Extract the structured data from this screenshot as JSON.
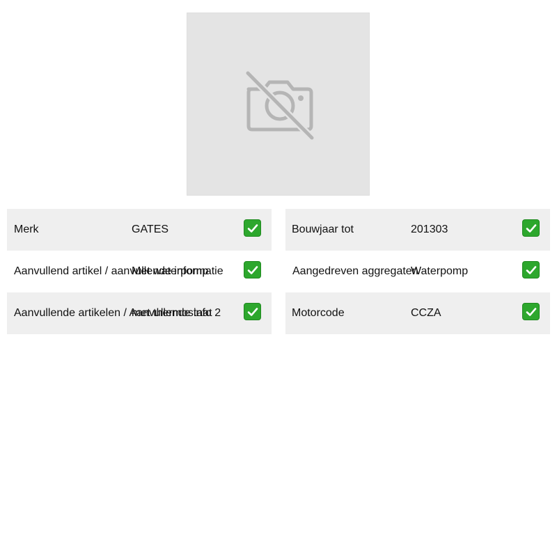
{
  "product_image": {
    "icon": "no-photo-camera-icon",
    "background_color": "#e4e4e4",
    "icon_color": "#b5b5b5"
  },
  "specs_left": [
    {
      "label": "Merk",
      "value": "GATES",
      "status_icon": "check-icon"
    },
    {
      "label": "Aanvullend artikel / aanvullende informatie",
      "value": "Met waterpomp",
      "status_icon": "check-icon"
    },
    {
      "label": "Aanvullende artikelen / Aanvullende info 2",
      "value": "met thermostaat",
      "status_icon": "check-icon"
    }
  ],
  "specs_right": [
    {
      "label": "Bouwjaar tot",
      "value": "201303",
      "status_icon": "check-icon"
    },
    {
      "label": "Aangedreven aggregaten",
      "value": "Waterpomp",
      "status_icon": "check-icon"
    },
    {
      "label": "Motorcode",
      "value": "CCZA",
      "status_icon": "check-icon"
    }
  ],
  "colors": {
    "row_shade": "#efefef",
    "check_green": "#2da72d"
  }
}
